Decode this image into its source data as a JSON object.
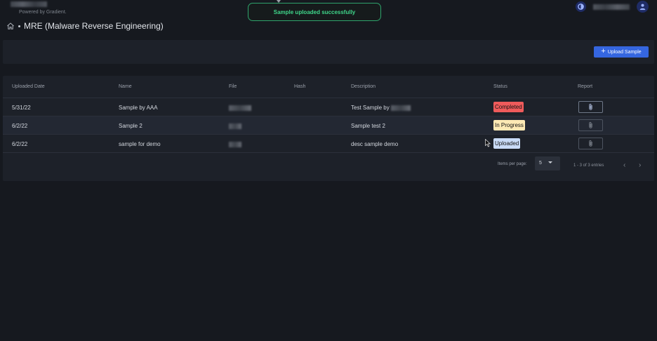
{
  "header": {
    "powered_by": "Powered by Gradient.",
    "toast": "Sample uploaded successfully",
    "theme_icon": "theme-toggle-icon",
    "user_icon": "user-icon"
  },
  "breadcrumb": {
    "home_icon": "home-icon",
    "title": "MRE (Malware Reverse Engineering)"
  },
  "toolbar": {
    "upload_label": "Upload Sample",
    "upload_icon": "plus-icon"
  },
  "table": {
    "columns": [
      "Uploaded Date",
      "Name",
      "File",
      "Hash",
      "Description",
      "Status",
      "Report"
    ],
    "rows": [
      {
        "date": "5/31/22",
        "name": "Sample by AAA",
        "description": "Test Sample by",
        "status": "Completed"
      },
      {
        "date": "6/2/22",
        "name": "Sample 2",
        "description": "Sample test 2",
        "status": "In Progress"
      },
      {
        "date": "6/2/22",
        "name": "sample for demo",
        "description": "desc sample demo",
        "status": "Uploaded"
      }
    ]
  },
  "pagination": {
    "items_per_page_label": "Items per page:",
    "items_per_page": "5",
    "range": "1 - 3 of 3 entries",
    "prev_label": "‹",
    "next_label": "›"
  },
  "colors": {
    "background": "#16191f",
    "panel": "#1d2129",
    "accent": "#3566e0",
    "toast": "#3fd68a",
    "completed": "#ef5b5b",
    "in_progress": "#fde9b4",
    "uploaded": "#c9dbf7"
  }
}
